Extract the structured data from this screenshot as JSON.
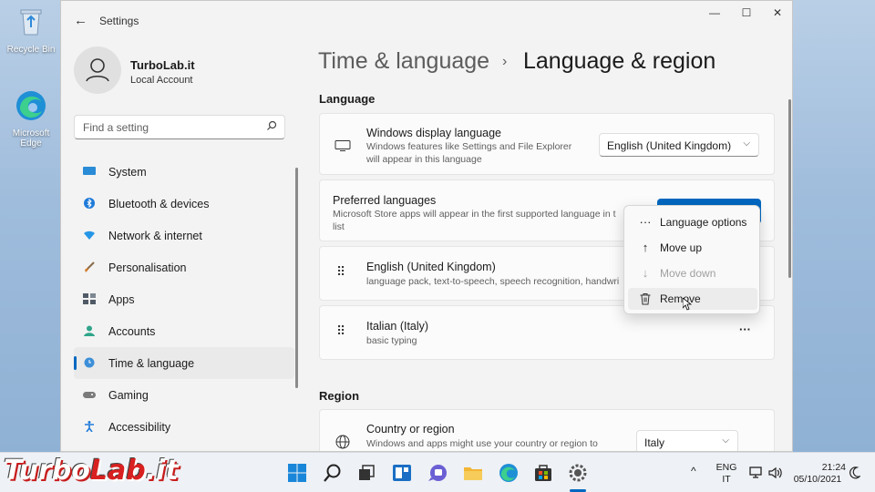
{
  "desktop": {
    "icons": [
      {
        "label": "Recycle Bin",
        "icon": "recycle-bin-icon"
      },
      {
        "label": "Microsoft Edge",
        "icon": "edge-icon"
      }
    ]
  },
  "window": {
    "title": "Settings",
    "controls": {
      "minimize": "—",
      "maximize": "☐",
      "close": "✕"
    },
    "back_glyph": "←"
  },
  "profile": {
    "name": "TurboLab.it",
    "account": "Local Account"
  },
  "search": {
    "placeholder": "Find a setting",
    "icon": "search-icon"
  },
  "nav": [
    {
      "label": "System",
      "icon": "monitor-icon",
      "color": "#2a8bd6"
    },
    {
      "label": "Bluetooth & devices",
      "icon": "bluetooth-icon",
      "color": "#1f7ad9"
    },
    {
      "label": "Network & internet",
      "icon": "wifi-icon",
      "color": "#2596e6"
    },
    {
      "label": "Personalisation",
      "icon": "brush-icon",
      "color": "#d17a2a"
    },
    {
      "label": "Apps",
      "icon": "apps-icon",
      "color": "#505a66"
    },
    {
      "label": "Accounts",
      "icon": "person-icon",
      "color": "#2fa58a"
    },
    {
      "label": "Time & language",
      "icon": "globe-clock-icon",
      "color": "#3c8fd8",
      "active": true
    },
    {
      "label": "Gaming",
      "icon": "gamepad-icon",
      "color": "#7a7a7a"
    },
    {
      "label": "Accessibility",
      "icon": "accessibility-icon",
      "color": "#1f7ad9"
    }
  ],
  "breadcrumb": {
    "parent": "Time & language",
    "separator": "›",
    "current": "Language & region"
  },
  "language_section": {
    "heading": "Language",
    "display_language": {
      "title": "Windows display language",
      "subtitle_line1": "Windows features like Settings and File Explorer",
      "subtitle_line2": "will appear in this language",
      "value": "English (United Kingdom)"
    },
    "preferred": {
      "title": "Preferred languages",
      "subtitle_line1": "Microsoft Store apps will appear in the first supported language in t",
      "subtitle_line2": "list"
    },
    "languages": [
      {
        "name": "English (United Kingdom)",
        "features": "language pack, text-to-speech, speech recognition, handwri"
      },
      {
        "name": "Italian (Italy)",
        "features": "basic typing",
        "more": "···"
      }
    ]
  },
  "context_menu": {
    "items": [
      {
        "label": "Language options",
        "icon": "more-icon",
        "glyph": "···",
        "enabled": true
      },
      {
        "label": "Move up",
        "icon": "arrow-up-icon",
        "glyph": "↑",
        "enabled": true
      },
      {
        "label": "Move down",
        "icon": "arrow-down-icon",
        "glyph": "↓",
        "enabled": false
      },
      {
        "label": "Remove",
        "icon": "trash-icon",
        "glyph": "🗑",
        "enabled": true
      }
    ]
  },
  "region_section": {
    "heading": "Region",
    "country": {
      "title": "Country or region",
      "subtitle_line1": "Windows and apps might use your country or region to",
      "value": "Italy"
    }
  },
  "taskbar": {
    "apps": [
      "start-icon",
      "search-icon",
      "task-view-icon",
      "widgets-icon",
      "chat-icon",
      "file-explorer-icon",
      "edge-icon",
      "store-icon",
      "settings-icon"
    ],
    "tray": {
      "chevron": "^",
      "lang_top": "ENG",
      "lang_bottom": "IT",
      "time": "21:24",
      "date": "05/10/2021"
    }
  },
  "watermark": {
    "part1": "Turbo",
    "part2": "Lab",
    "part3": ".it"
  },
  "colors": {
    "accent": "#0067c0",
    "window_bg": "#f3f3f3",
    "card_bg": "#fbfbfb"
  }
}
